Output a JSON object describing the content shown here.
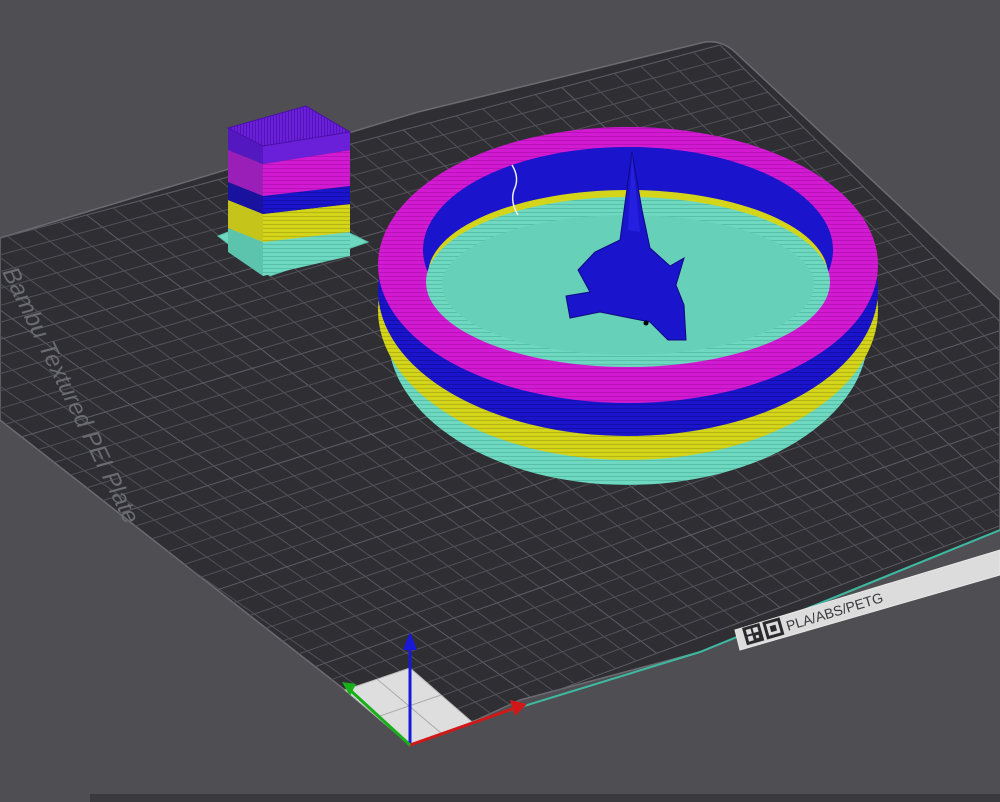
{
  "plate": {
    "name_label": "Bambu Textured PEI Plate",
    "material_label": "PLA/ABS/PETG"
  },
  "colors": {
    "background": "#4f4f53",
    "plate": "#2f2f33",
    "grid": "#505057",
    "purge_block_top": "#6a1fd8",
    "magenta": "#d21ad2",
    "blue": "#1a14cc",
    "yellow": "#d4d41a",
    "teal": "#6fd8c0",
    "axis_x": "#d01818",
    "axis_y": "#18b018",
    "axis_z": "#1818d8",
    "edge_line": "#3fb8a0"
  },
  "icons": [
    "qr-code-icon",
    "axis-gizmo-icon"
  ]
}
